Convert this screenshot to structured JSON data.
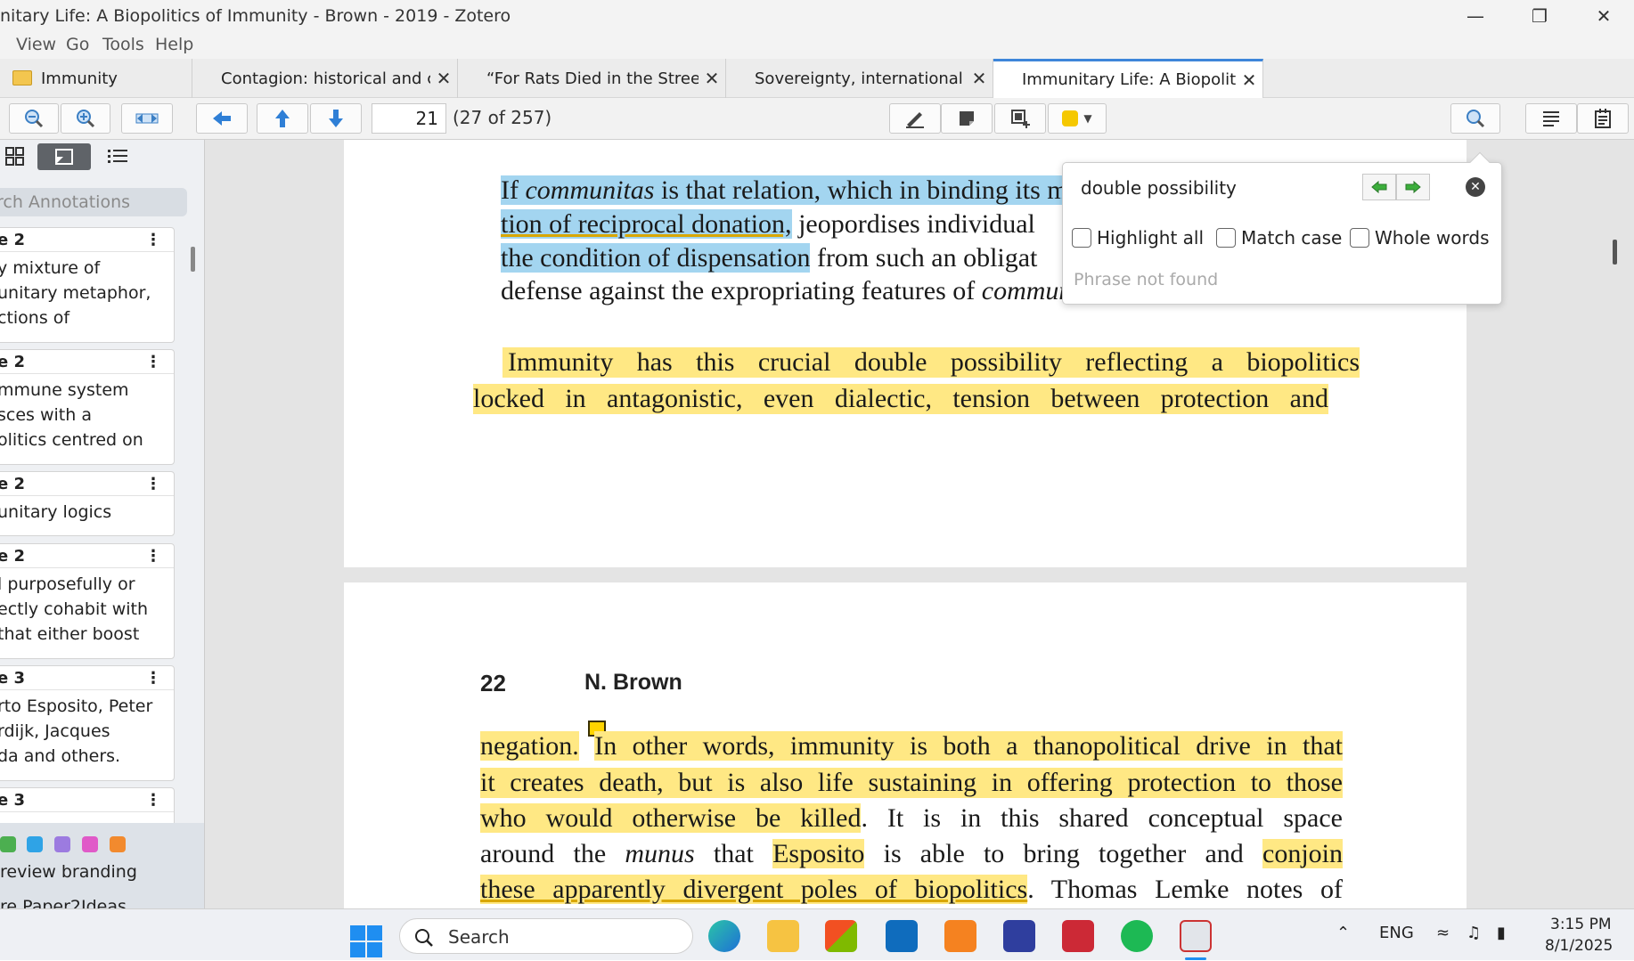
{
  "window": {
    "title": "nitary Life: A Biopolitics of Immunity - Brown - 2019 - Zotero"
  },
  "menu": [
    "View",
    "Go",
    "Tools",
    "Help"
  ],
  "tabs": [
    {
      "label": "Immunity"
    },
    {
      "label": "Contagion: historical and c..."
    },
    {
      "label": "“For Rats Died in the Street;..."
    },
    {
      "label": "Sovereignty, international l..."
    },
    {
      "label": "Immunitary Life: A Biopoliti..."
    }
  ],
  "toolbar": {
    "page_value": "21",
    "page_count": "(27 of 257)",
    "highlight_color": "#f5c800"
  },
  "sidebar": {
    "search_placeholder": "rch Annotations",
    "cards": [
      {
        "header": "e 2",
        "lines": [
          "y mixture of",
          "unitary metaphor,",
          "ctions of"
        ]
      },
      {
        "header": "e 2",
        "lines": [
          "mmune system",
          "sces with a",
          "olitics centred on"
        ]
      },
      {
        "header": "e 2",
        "lines": [
          "unitary logics"
        ]
      },
      {
        "header": "e 2",
        "lines": [
          "l purposefully or",
          "ectly cohabit with",
          " that either boost"
        ]
      },
      {
        "header": "e 3",
        "lines": [
          "rto Esposito, Peter",
          "rdijk, Jacques",
          "da and others."
        ]
      },
      {
        "header": "e 3",
        "lines": []
      }
    ],
    "color_swatches": [
      "#4caf50",
      "#2fa3e6",
      "#9c7be0",
      "#e05ac8",
      "#f28a2e"
    ],
    "tags_row1": "review    branding",
    "tags_row2": "re    Paper2Ideas"
  },
  "document": {
    "page1": {
      "line1_pre": "If ",
      "line1_em": "communitas",
      "line1_post": " is that relation, which in binding its m",
      "line2_hl": "tion of reciprocal donation,",
      "line2_rest": " jeopordises individual",
      "line3_hl": "the condition of dispensation",
      "line3_rest": " from such an obligat",
      "line4_pre": "defense against the expropriating features of ",
      "line4_em": "commun",
      "quote1": "Immunity has this crucial double possibility reflecting a biopolitics",
      "quote2": "locked in antagonistic, even dialectic, tension between protection and"
    },
    "page2": {
      "page_number": "22",
      "running_head": "N. Brown",
      "l1_hl1": "negation.",
      "l1_hl2": "In other words, immunity is both a thanopolitical drive in that",
      "l2": "it creates death, but is also life sustaining in offering protection to those",
      "l3_hl": "who would otherwise be killed",
      "l3_rest": ". It is in this shared conceptual space",
      "l4_a": "around the ",
      "l4_em": "munus",
      "l4_b": " that ",
      "l4_hl1": "Esposito",
      "l4_c": " is able to bring together and ",
      "l4_hl2": "conjoin",
      "l5_hl": "these apparently divergent poles of biopolitics",
      "l5_rest": ". Thomas Lemke notes of"
    }
  },
  "find": {
    "query": "double possibility",
    "highlight_all": "Highlight all",
    "match_case": "Match case",
    "whole_words": "Whole words",
    "status": "Phrase not found"
  },
  "taskbar": {
    "search_label": "Search",
    "lang": "ENG",
    "time": "3:15 PM",
    "date": "8/1/2025"
  }
}
